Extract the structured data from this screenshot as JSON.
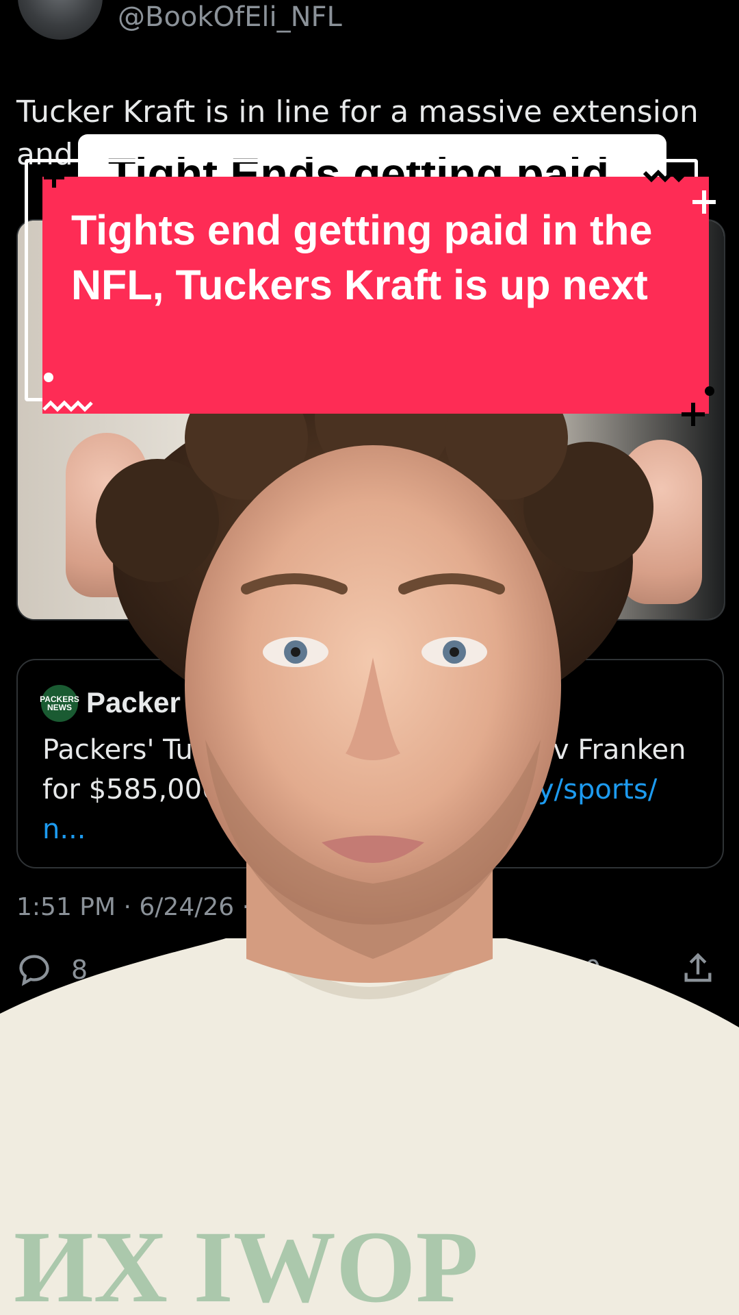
{
  "tweet": {
    "handle": "@BookOfEli_NFL",
    "text_line1": "Tucker Kraft is in line for a massive extension",
    "text_line2": "and",
    "link_card": {
      "source": "Packer",
      "logo_text": "PACKERS NEWS",
      "line1_left": "Packers' Tu",
      "line1_right": "v Franken",
      "line2_left": "for $585,000",
      "line2_right": "y/sports/",
      "line3": "n..."
    },
    "timestamp": "1:51 PM · 6/24/26 ·",
    "stats": {
      "replies": "8",
      "likes": "10"
    }
  },
  "overlay_banner": "Tight Ends getting paid",
  "caption": "Tights end getting paid in the NFL, Tuckers Kraft is up next",
  "colors": {
    "caption_bg": "#fe2c55",
    "link": "#1d9bf0",
    "muted": "#8b9299"
  },
  "icons": [
    "reply-icon",
    "share-icon",
    "repost-icon"
  ]
}
